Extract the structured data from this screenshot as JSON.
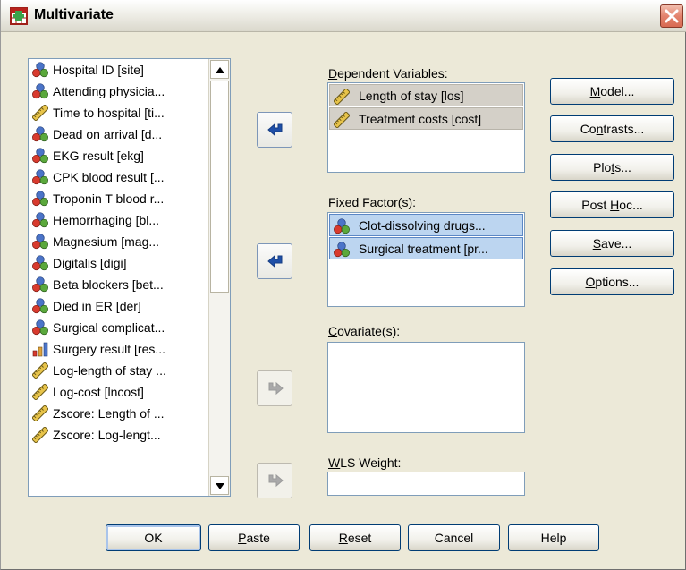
{
  "window": {
    "title": "Multivariate"
  },
  "source_variables": [
    {
      "label": "Hospital ID [site]",
      "icon": "nominal-icon"
    },
    {
      "label": "Attending physicia...",
      "icon": "nominal-icon"
    },
    {
      "label": "Time to hospital [ti...",
      "icon": "scale-icon"
    },
    {
      "label": "Dead on arrival [d...",
      "icon": "nominal-icon"
    },
    {
      "label": "EKG result [ekg]",
      "icon": "nominal-icon"
    },
    {
      "label": "CPK blood result [...",
      "icon": "nominal-icon"
    },
    {
      "label": "Troponin T blood r...",
      "icon": "nominal-icon"
    },
    {
      "label": "Hemorrhaging [bl...",
      "icon": "nominal-icon"
    },
    {
      "label": "Magnesium [mag...",
      "icon": "nominal-icon"
    },
    {
      "label": "Digitalis [digi]",
      "icon": "nominal-icon"
    },
    {
      "label": "Beta blockers [bet...",
      "icon": "nominal-icon"
    },
    {
      "label": "Died in ER [der]",
      "icon": "nominal-icon"
    },
    {
      "label": "Surgical complicat...",
      "icon": "nominal-icon"
    },
    {
      "label": "Surgery result [res...",
      "icon": "ordinal-icon"
    },
    {
      "label": "Log-length of stay ...",
      "icon": "scale-icon"
    },
    {
      "label": "Log-cost [lncost]",
      "icon": "scale-icon"
    },
    {
      "label": "Zscore:  Length of ...",
      "icon": "scale-icon"
    },
    {
      "label": "Zscore:  Log-lengt...",
      "icon": "scale-icon"
    }
  ],
  "dependent": {
    "label": {
      "pre": "",
      "key": "D",
      "post": "ependent Variables:"
    },
    "items": [
      "Length of stay [los]",
      "Treatment costs [cost]"
    ]
  },
  "fixed": {
    "label": {
      "pre": "",
      "key": "F",
      "post": "ixed Factor(s):"
    },
    "items": [
      "Clot-dissolving drugs...",
      "Surgical treatment [pr..."
    ]
  },
  "covariates": {
    "label": {
      "pre": "",
      "key": "C",
      "post": "ovariate(s):"
    }
  },
  "wls": {
    "label": {
      "pre": "",
      "key": "W",
      "post": "LS Weight:"
    },
    "value": ""
  },
  "side_buttons": {
    "model": {
      "pre": "",
      "key": "M",
      "post": "odel..."
    },
    "contrasts": {
      "pre": "Co",
      "key": "n",
      "post": "trasts..."
    },
    "plots": {
      "pre": "Plo",
      "key": "t",
      "post": "s..."
    },
    "posthoc": {
      "pre": "Post ",
      "key": "H",
      "post": "oc..."
    },
    "save": {
      "pre": "",
      "key": "S",
      "post": "ave..."
    },
    "options": {
      "pre": "",
      "key": "O",
      "post": "ptions..."
    }
  },
  "bottom_buttons": {
    "ok": {
      "pre": "OK",
      "key": "",
      "post": ""
    },
    "paste": {
      "pre": "",
      "key": "P",
      "post": "aste"
    },
    "reset": {
      "pre": "",
      "key": "R",
      "post": "eset"
    },
    "cancel": {
      "pre": "Cancel",
      "key": "",
      "post": ""
    },
    "help": {
      "pre": "Help",
      "key": "",
      "post": ""
    }
  },
  "colors": {
    "nominal_red": "#d83a2e",
    "nominal_blue": "#4b74c8",
    "nominal_green": "#5aa83c",
    "scale_ruler": "#e8c44a",
    "selection_blue": "#bcd5f0",
    "selection_gray": "#d4d0c8"
  }
}
